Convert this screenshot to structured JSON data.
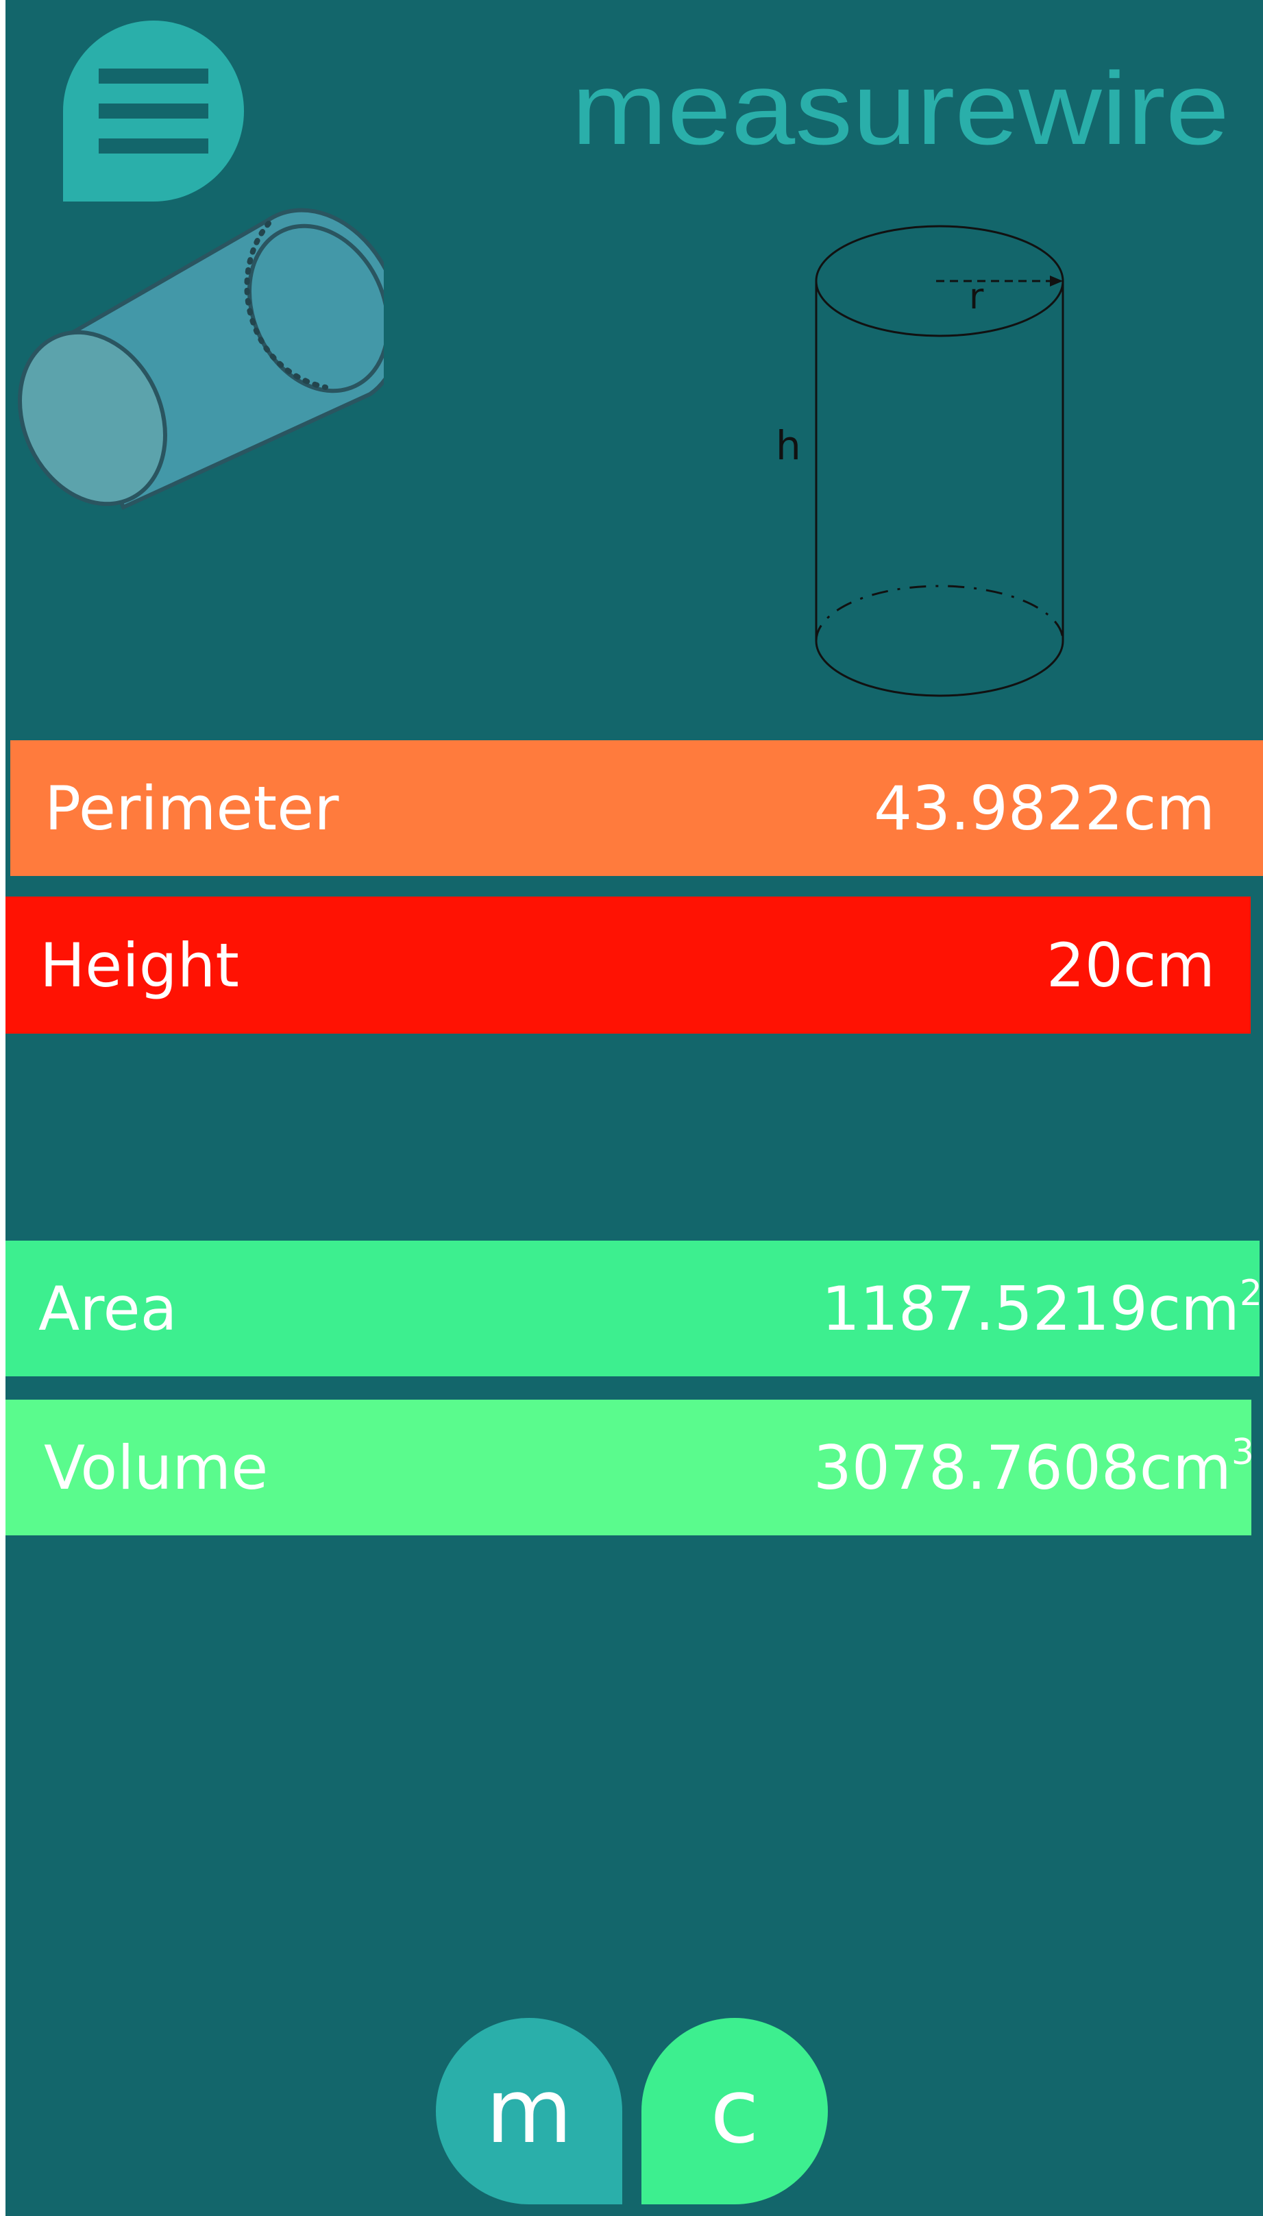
{
  "header": {
    "logo_text": "measurewire",
    "logo_color": "#2aafaa",
    "menu_icon": "hamburger-menu-icon"
  },
  "diagram": {
    "radius_label": "r",
    "height_label": "h"
  },
  "results": {
    "perimeter": {
      "label": "Perimeter",
      "value": "43.9822cm",
      "color": "#ff7b3d"
    },
    "height": {
      "label": "Height",
      "value": "20cm",
      "color": "#ff1203"
    },
    "area": {
      "label": "Area",
      "value": "1187.5219cm",
      "unit_power": "2",
      "color": "#3def8f"
    },
    "volume": {
      "label": "Volume",
      "value": "3078.7608cm",
      "unit_power": "3",
      "color": "#5afb8d"
    }
  },
  "units": {
    "metric_label": "m",
    "custom_label": "c"
  },
  "colors": {
    "background": "#13666b",
    "accent": "#2aafaa"
  }
}
